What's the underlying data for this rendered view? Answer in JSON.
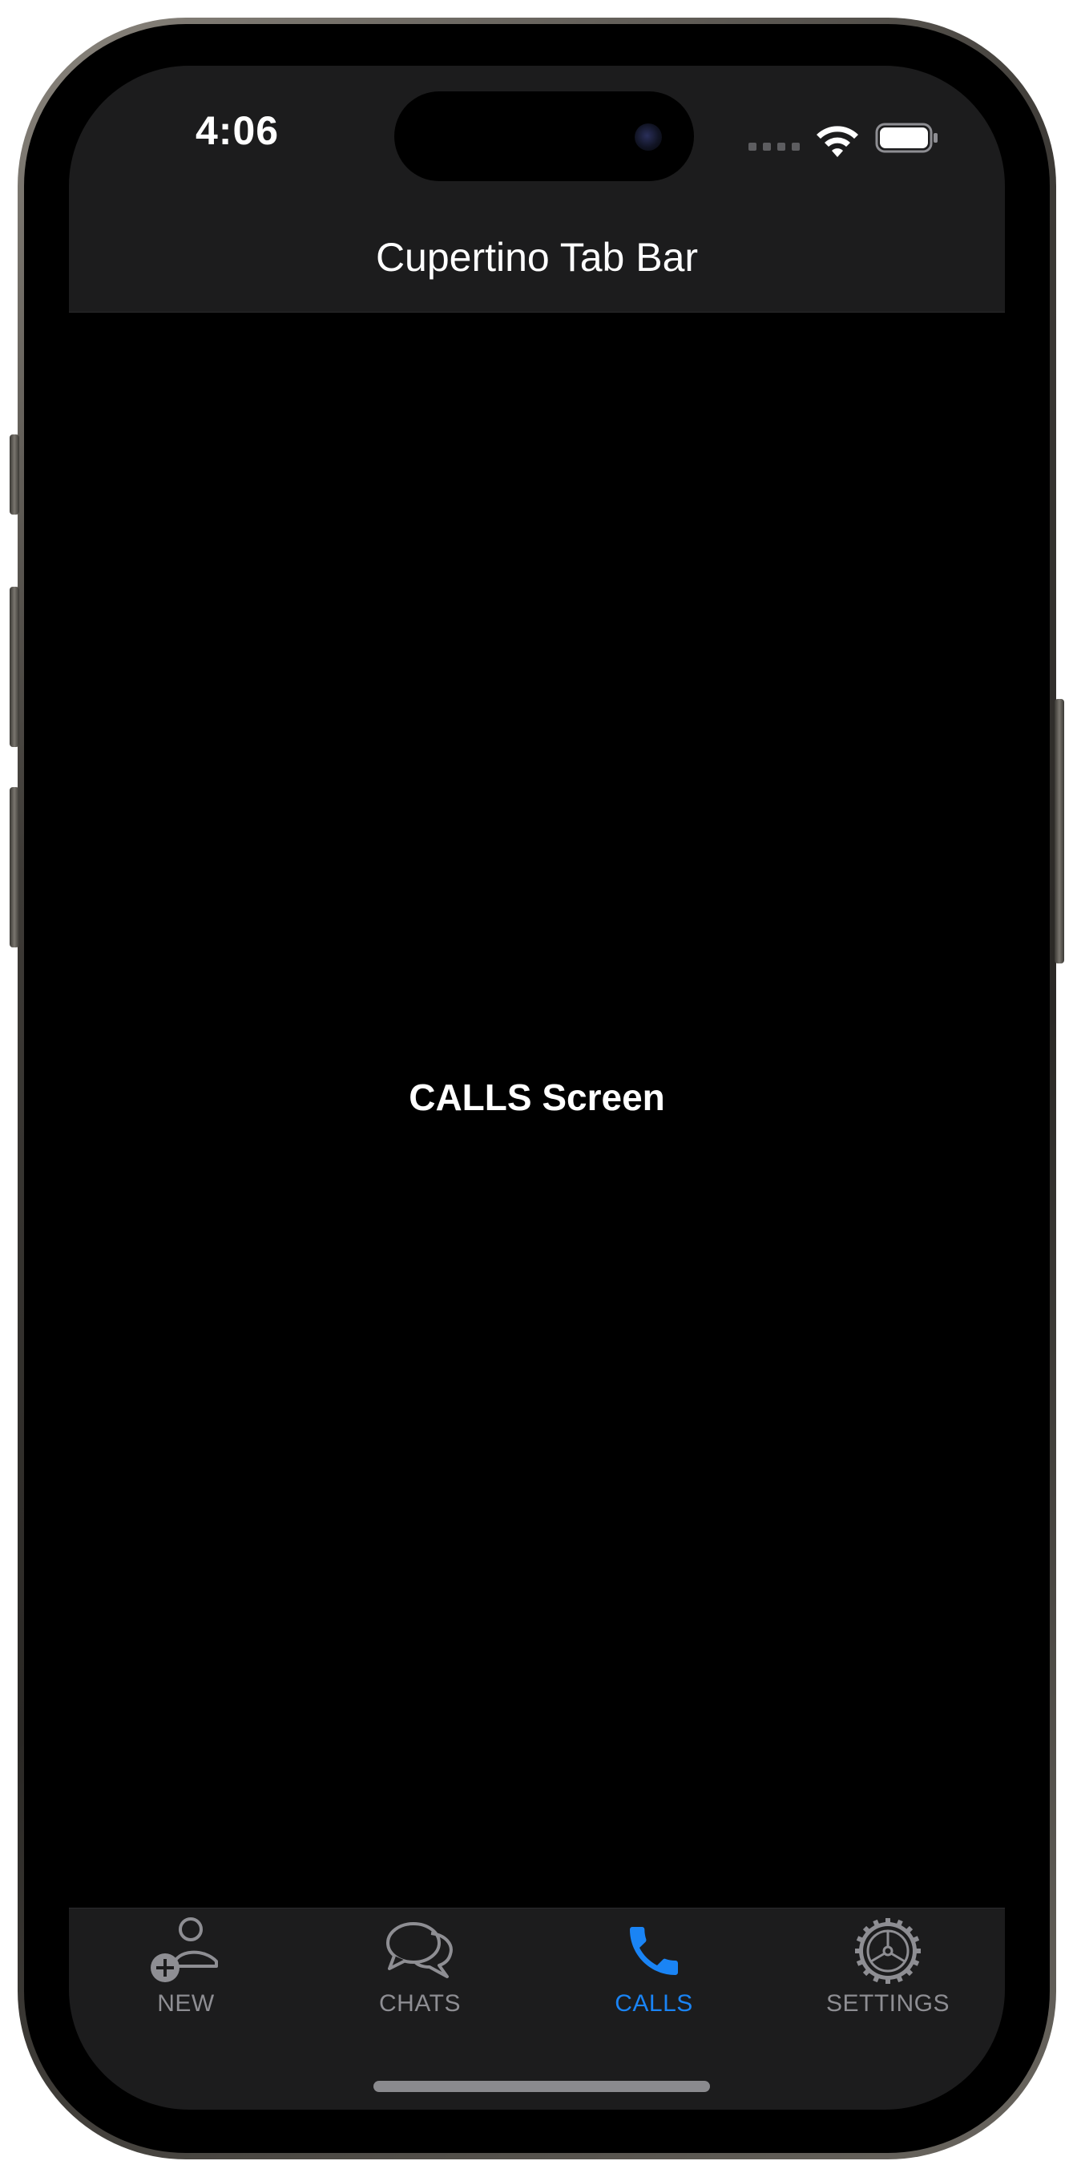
{
  "status_bar": {
    "time": "4:06"
  },
  "nav": {
    "title": "Cupertino Tab Bar"
  },
  "main": {
    "label": "CALLS Screen"
  },
  "tabs": [
    {
      "label": "NEW",
      "icon": "person-add-icon",
      "active": false
    },
    {
      "label": "CHATS",
      "icon": "chat-bubbles-icon",
      "active": false
    },
    {
      "label": "CALLS",
      "icon": "phone-icon",
      "active": true
    },
    {
      "label": "SETTINGS",
      "icon": "gear-icon",
      "active": false
    }
  ],
  "colors": {
    "accent": "#1a84f5",
    "inactive": "#8e8e93",
    "bar_background": "#1c1c1d",
    "screen_background": "#000000"
  }
}
